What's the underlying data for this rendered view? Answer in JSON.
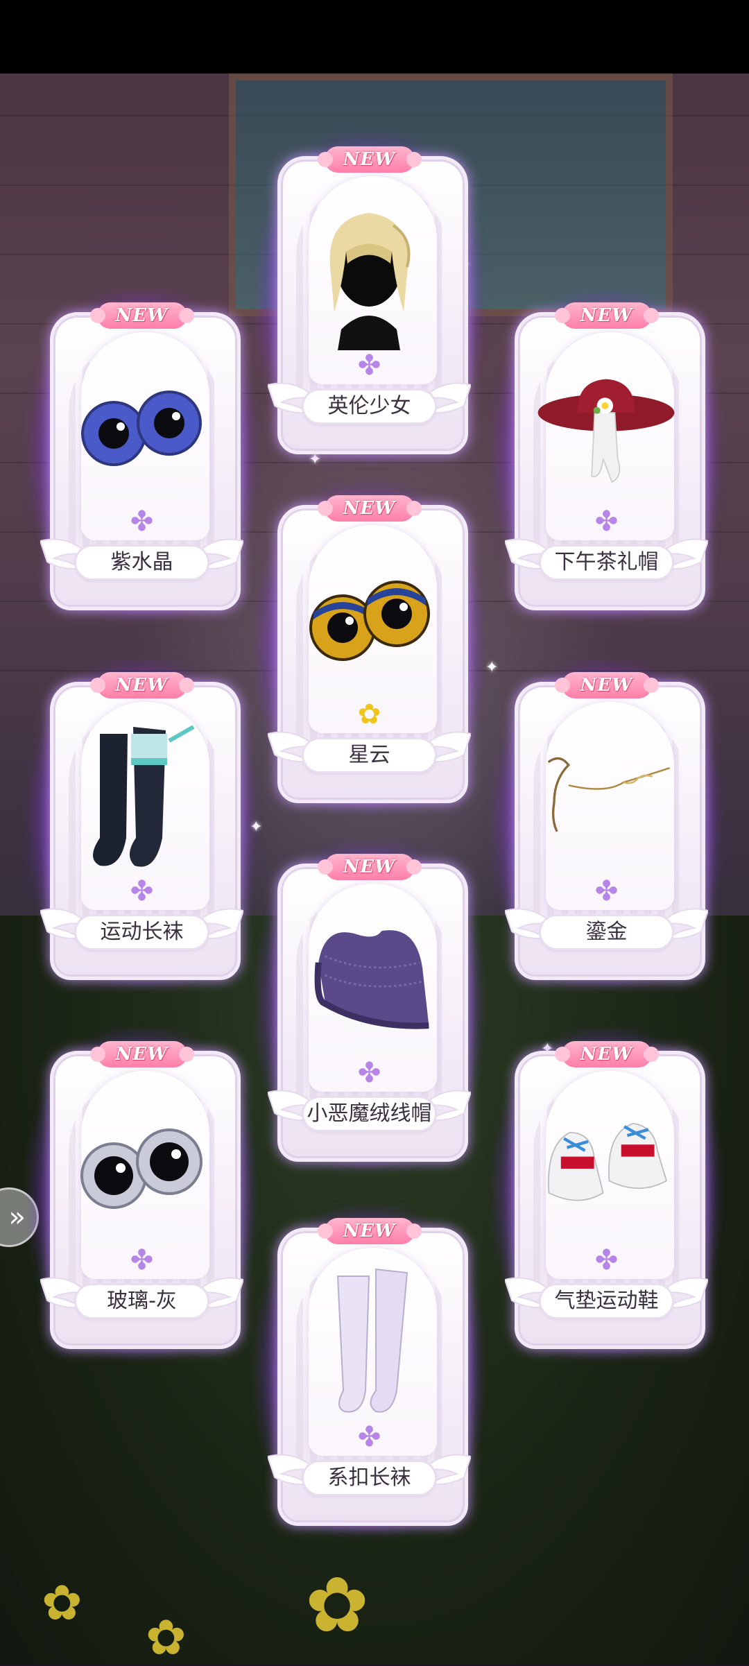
{
  "badge_text": "NEW",
  "side_button_glyph": "»",
  "cards": [
    {
      "name": "英伦少女",
      "item": "blonde-bob-wig",
      "rarity": "purple-flower"
    },
    {
      "name": "紫水晶",
      "item": "purple-eyes",
      "rarity": "purple-flower"
    },
    {
      "name": "下午茶礼帽",
      "item": "red-sun-hat",
      "rarity": "purple-flower"
    },
    {
      "name": "星云",
      "item": "nebula-eyes",
      "rarity": "gold-flower"
    },
    {
      "name": "运动长袜",
      "item": "black-sport-socks",
      "rarity": "purple-flower"
    },
    {
      "name": "鎏金",
      "item": "gold-glasses-chain",
      "rarity": "purple-flower"
    },
    {
      "name": "小恶魔绒线帽",
      "item": "purple-knit-hat",
      "rarity": "purple-flower"
    },
    {
      "name": "玻璃-灰",
      "item": "grey-glass-eyes",
      "rarity": "purple-flower"
    },
    {
      "name": "气垫运动鞋",
      "item": "white-sneakers",
      "rarity": "purple-flower"
    },
    {
      "name": "系扣长袜",
      "item": "lavender-long-socks",
      "rarity": "purple-flower"
    }
  ],
  "colors": {
    "card_glow": "#a45aff",
    "badge": "#ff7ea8",
    "rarity_purple": "#b784e8",
    "rarity_gold": "#f0c419"
  }
}
